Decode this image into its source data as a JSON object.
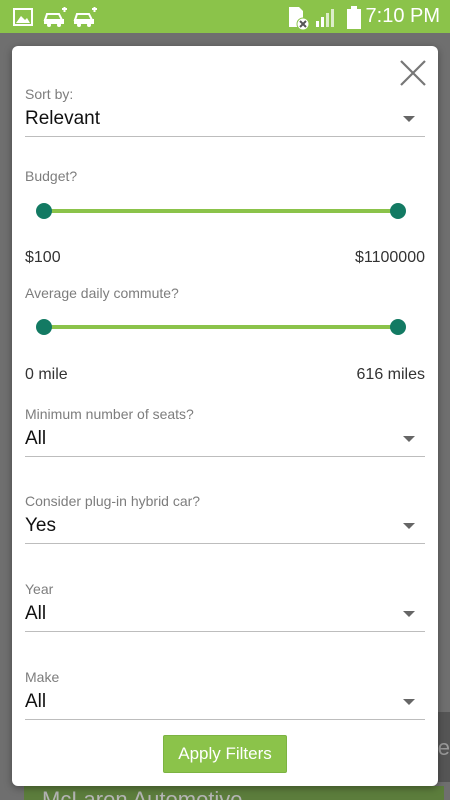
{
  "status_bar": {
    "time": "7:10 PM",
    "icons": [
      "image-icon",
      "car-icon",
      "car-icon",
      "sim-error-icon",
      "signal-icon",
      "battery-icon"
    ]
  },
  "background": {
    "side_text": "e",
    "bottom_text": "McLaren Automotive"
  },
  "filters": {
    "sort_by": {
      "label": "Sort by:",
      "value": "Relevant"
    },
    "budget": {
      "label": "Budget?",
      "min": "$100",
      "max": "$1100000",
      "low_fraction": 0.0,
      "high_fraction": 1.0
    },
    "commute": {
      "label": "Average daily commute?",
      "min": "0 mile",
      "max": "616 miles",
      "low_fraction": 0.0,
      "high_fraction": 1.0
    },
    "seats": {
      "label": "Minimum number of seats?",
      "value": "All"
    },
    "plugin_hybrid": {
      "label": "Consider plug-in hybrid car?",
      "value": "Yes"
    },
    "year": {
      "label": "Year",
      "value": "All"
    },
    "make": {
      "label": "Make",
      "value": "All"
    }
  },
  "apply_button": "Apply Filters",
  "colors": {
    "accent": "#8bc34a",
    "thumb": "#137a63",
    "overlay": "#7a7a7a"
  }
}
